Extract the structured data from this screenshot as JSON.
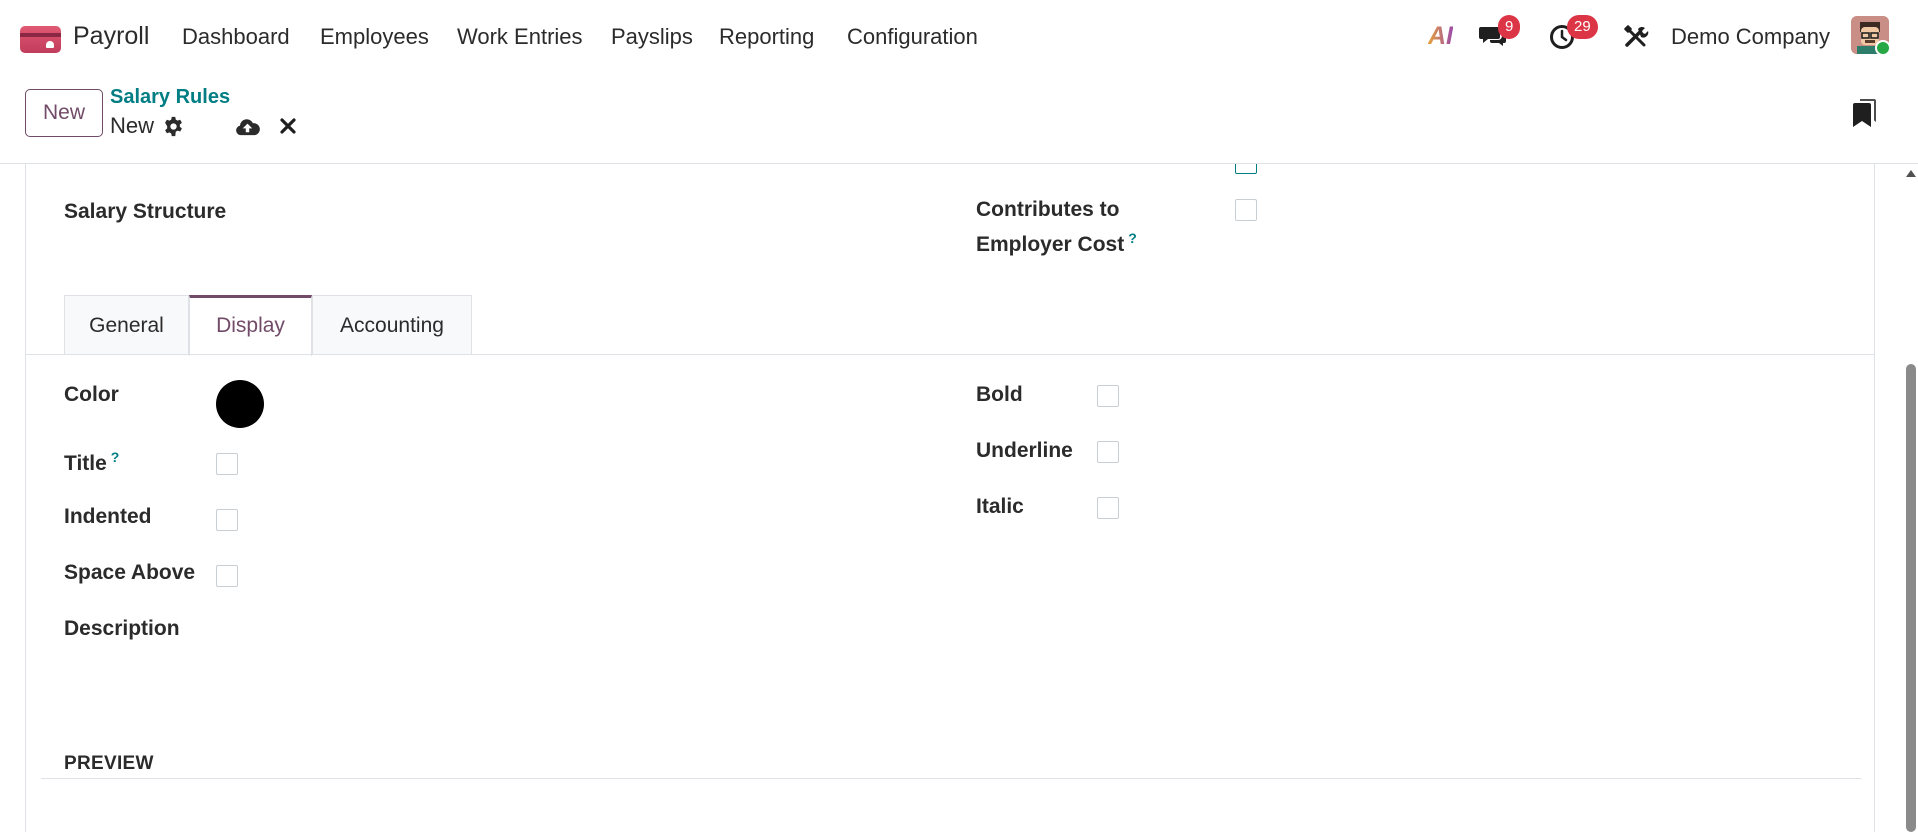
{
  "navbar": {
    "app_name": "Payroll",
    "menu": [
      "Dashboard",
      "Employees",
      "Work Entries",
      "Payslips",
      "Reporting",
      "Configuration"
    ],
    "ai_label": "AI",
    "messages_count": "9",
    "activities_count": "29",
    "company": "Demo Company",
    "icons": [
      "payroll-app-icon",
      "chat-icon",
      "clock-icon",
      "tools-icon",
      "avatar"
    ]
  },
  "control_panel": {
    "new_button": "New",
    "breadcrumb": "Salary Rules",
    "record_name": "New",
    "icons": [
      "gear-icon",
      "cloud-upload-icon",
      "close-icon",
      "bookmark-icon"
    ]
  },
  "form": {
    "salary_structure_label": "Salary Structure",
    "contributes_label_line1": "Contributes to",
    "contributes_label_line2": "Employer Cost",
    "help_mark": "?",
    "tabs": [
      "General",
      "Display",
      "Accounting"
    ],
    "active_tab": "Display",
    "display": {
      "color_label": "Color",
      "color_value": "#000000",
      "title_label": "Title",
      "indented_label": "Indented",
      "space_above_label": "Space Above",
      "description_label": "Description",
      "bold_label": "Bold",
      "underline_label": "Underline",
      "italic_label": "Italic"
    },
    "preview_label": "PREVIEW"
  },
  "colors": {
    "brand": "#714b67",
    "link": "#017e84",
    "badge": "#dc3545"
  }
}
